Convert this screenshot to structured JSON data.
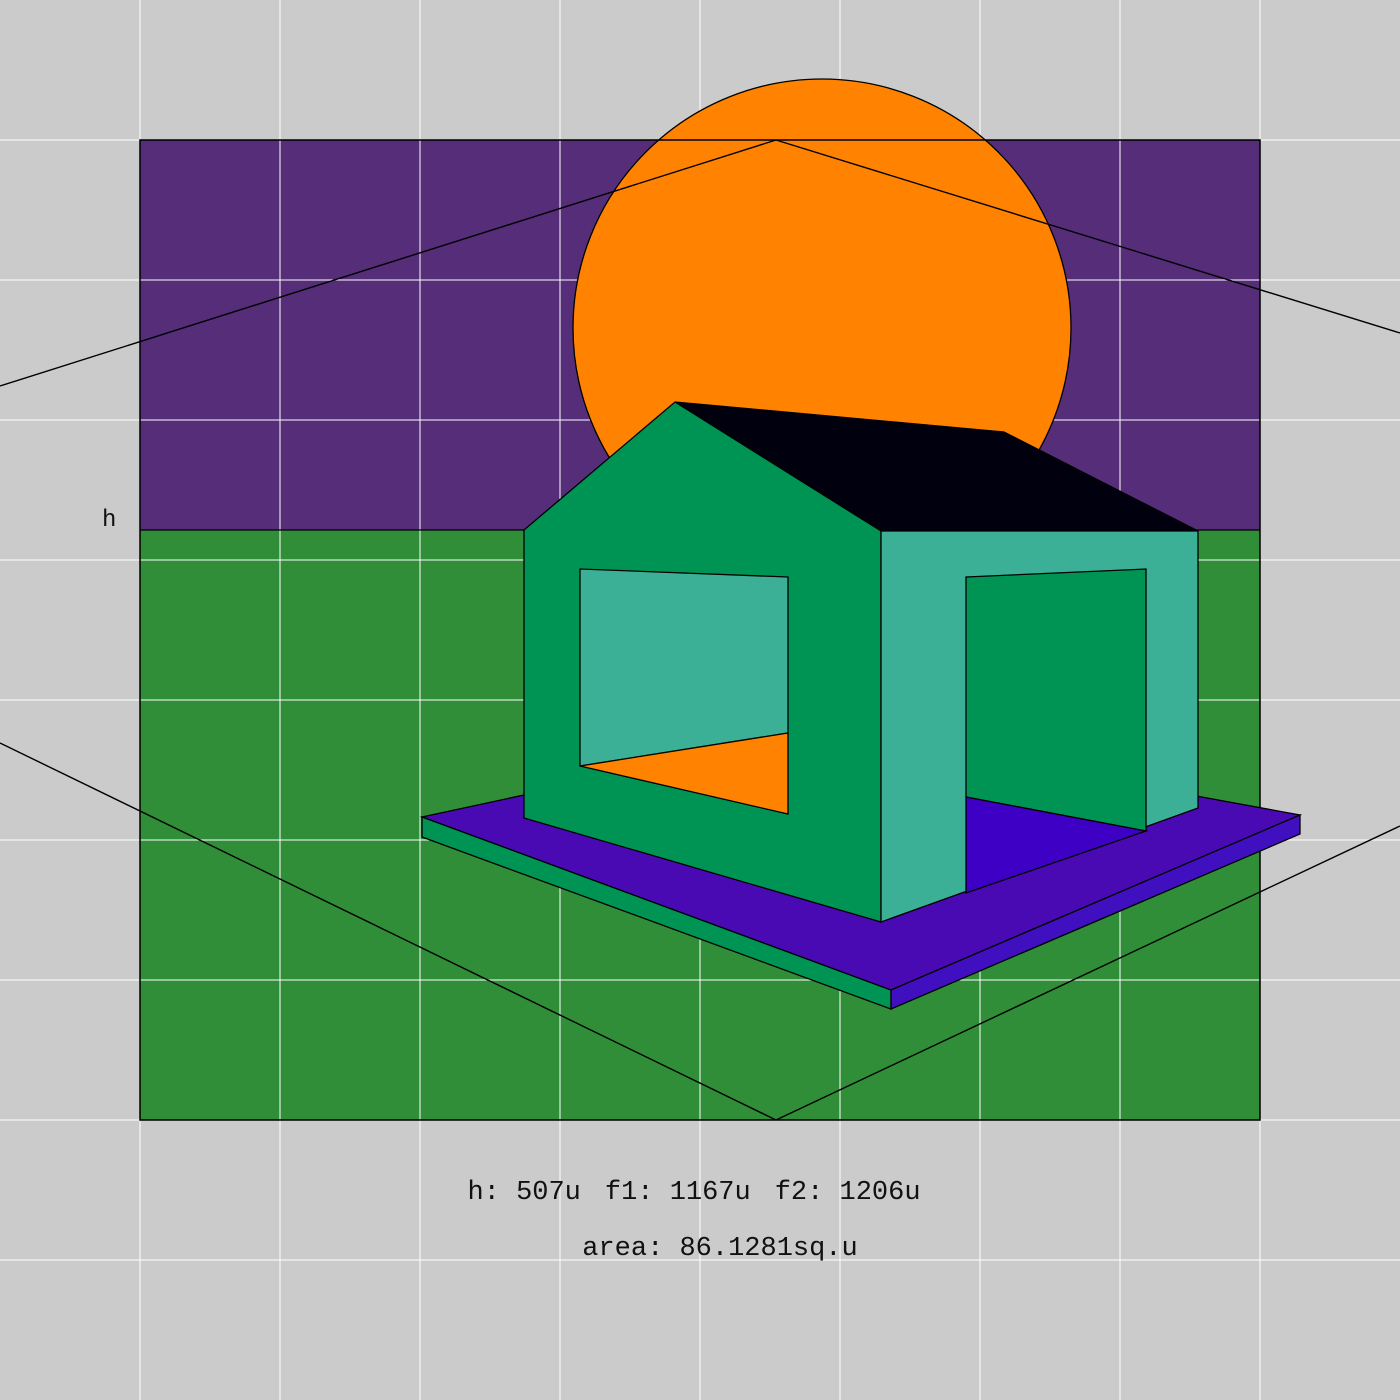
{
  "colors": {
    "background": "#cbcbcb",
    "grid_line": "#ffffff",
    "sky": "#552d78",
    "ground": "#318e38",
    "sun": "#ff8300",
    "wall_front": "#009454",
    "wall_side": "#3bb096",
    "roof": "#00000e",
    "platform_top": "#4a0ab3",
    "platform_edge_side": "#4010c0",
    "interior_floor": "#3e00c4",
    "outline": "#000000"
  },
  "icons": {
    "sun": "sun-disc",
    "house": "house-block"
  },
  "horizon_label": "h",
  "readout": {
    "h_label": "h:",
    "h_value": "507u",
    "f1_label": "f1:",
    "f1_value": "1167u",
    "f2_label": "f2:",
    "f2_value": "1206u",
    "area_label": "area:",
    "area_value": "86.1281sq.u"
  }
}
